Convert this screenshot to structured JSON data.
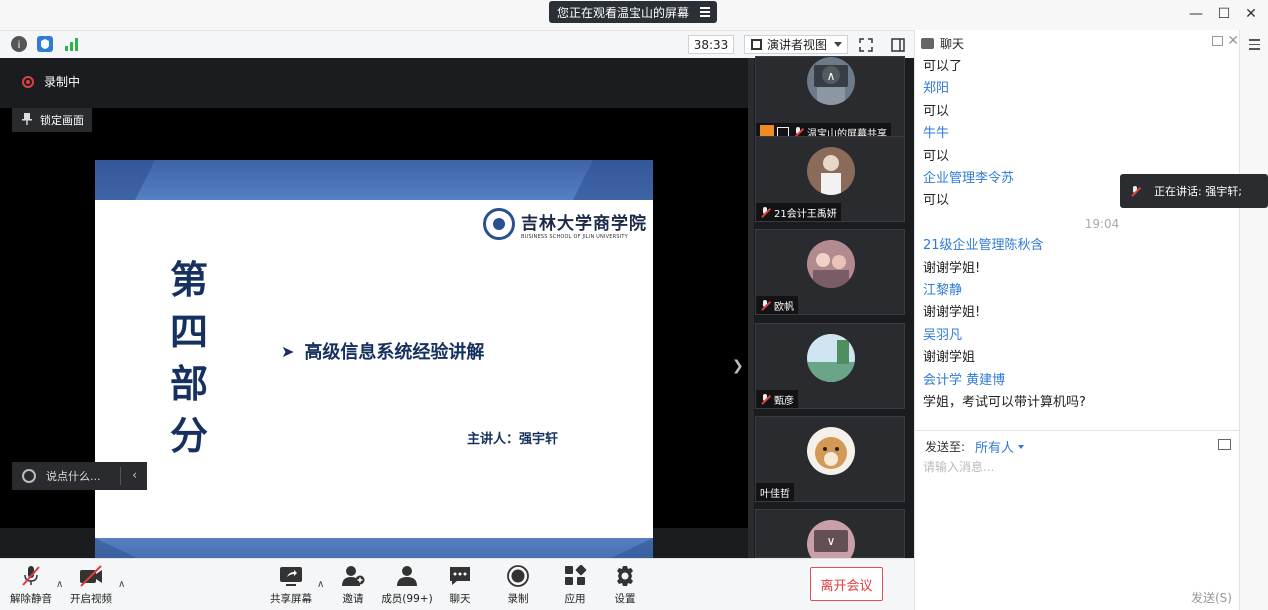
{
  "window": {
    "share_banner": "您正在观看温宝山的屏幕",
    "minimize": "—",
    "maximize": "☐",
    "close": "✕"
  },
  "topbar": {
    "timer": "38:33",
    "view_mode": "演讲者视图"
  },
  "stage": {
    "recording": "录制中",
    "lock_view": "锁定画面",
    "say_placeholder": "说点什么...",
    "slide": {
      "logo_cn": "吉林大学商学院",
      "logo_en": "BUSINESS SCHOOL OF JILIN UNIVERSITY",
      "vertical_title": [
        "第",
        "四",
        "部",
        "分"
      ],
      "bullet": "高级信息系统经验讲解",
      "presenter": "主讲人：强宇轩"
    }
  },
  "participants": [
    {
      "name": "温宝山的屏幕共享",
      "avatar_color": "#6d7a88"
    },
    {
      "name": "21会计王禹妍",
      "avatar_color": "#8a6b5a"
    },
    {
      "name": "欧帆",
      "avatar_color": "#b38a8f"
    },
    {
      "name": "甄彦",
      "avatar_color": "#6aa58a"
    },
    {
      "name": "叶佳哲",
      "avatar_color": "#d49a55"
    },
    {
      "name": "",
      "avatar_color": "#c9a0a8"
    }
  ],
  "controls": {
    "unmute": "解除静音",
    "start_video": "开启视频",
    "share_screen": "共享屏幕",
    "invite": "邀请",
    "members": "成员(99+)",
    "chat": "聊天",
    "record": "录制",
    "apps": "应用",
    "settings": "设置",
    "leave": "离开会议"
  },
  "chat": {
    "title": "聊天",
    "messages": [
      {
        "type": "text",
        "value": "可以了"
      },
      {
        "type": "sender",
        "value": "郑阳"
      },
      {
        "type": "text",
        "value": "可以"
      },
      {
        "type": "sender",
        "value": "牛牛"
      },
      {
        "type": "text",
        "value": "可以"
      },
      {
        "type": "sender",
        "value": "企业管理李令苏"
      },
      {
        "type": "text",
        "value": "可以"
      },
      {
        "type": "time",
        "value": "19:04"
      },
      {
        "type": "sender",
        "value": "21级企业管理陈秋含"
      },
      {
        "type": "text",
        "value": "谢谢学姐!"
      },
      {
        "type": "sender",
        "value": "江黎静"
      },
      {
        "type": "text",
        "value": "谢谢学姐!"
      },
      {
        "type": "sender",
        "value": "吴羽凡"
      },
      {
        "type": "text",
        "value": "谢谢学姐"
      },
      {
        "type": "sender",
        "value": "会计学 黄建博"
      },
      {
        "type": "text",
        "value": "学姐，考试可以带计算机吗?"
      }
    ],
    "speaking": "正在讲话: 强宇轩;",
    "send_to_label": "发送至:",
    "send_to_target": "所有人",
    "input_placeholder": "请输入消息...",
    "send_button": "发送(S)"
  },
  "colors": {
    "accent": "#2f7bd6",
    "leave": "#e03c3c",
    "slide_blue": "#16305f"
  }
}
